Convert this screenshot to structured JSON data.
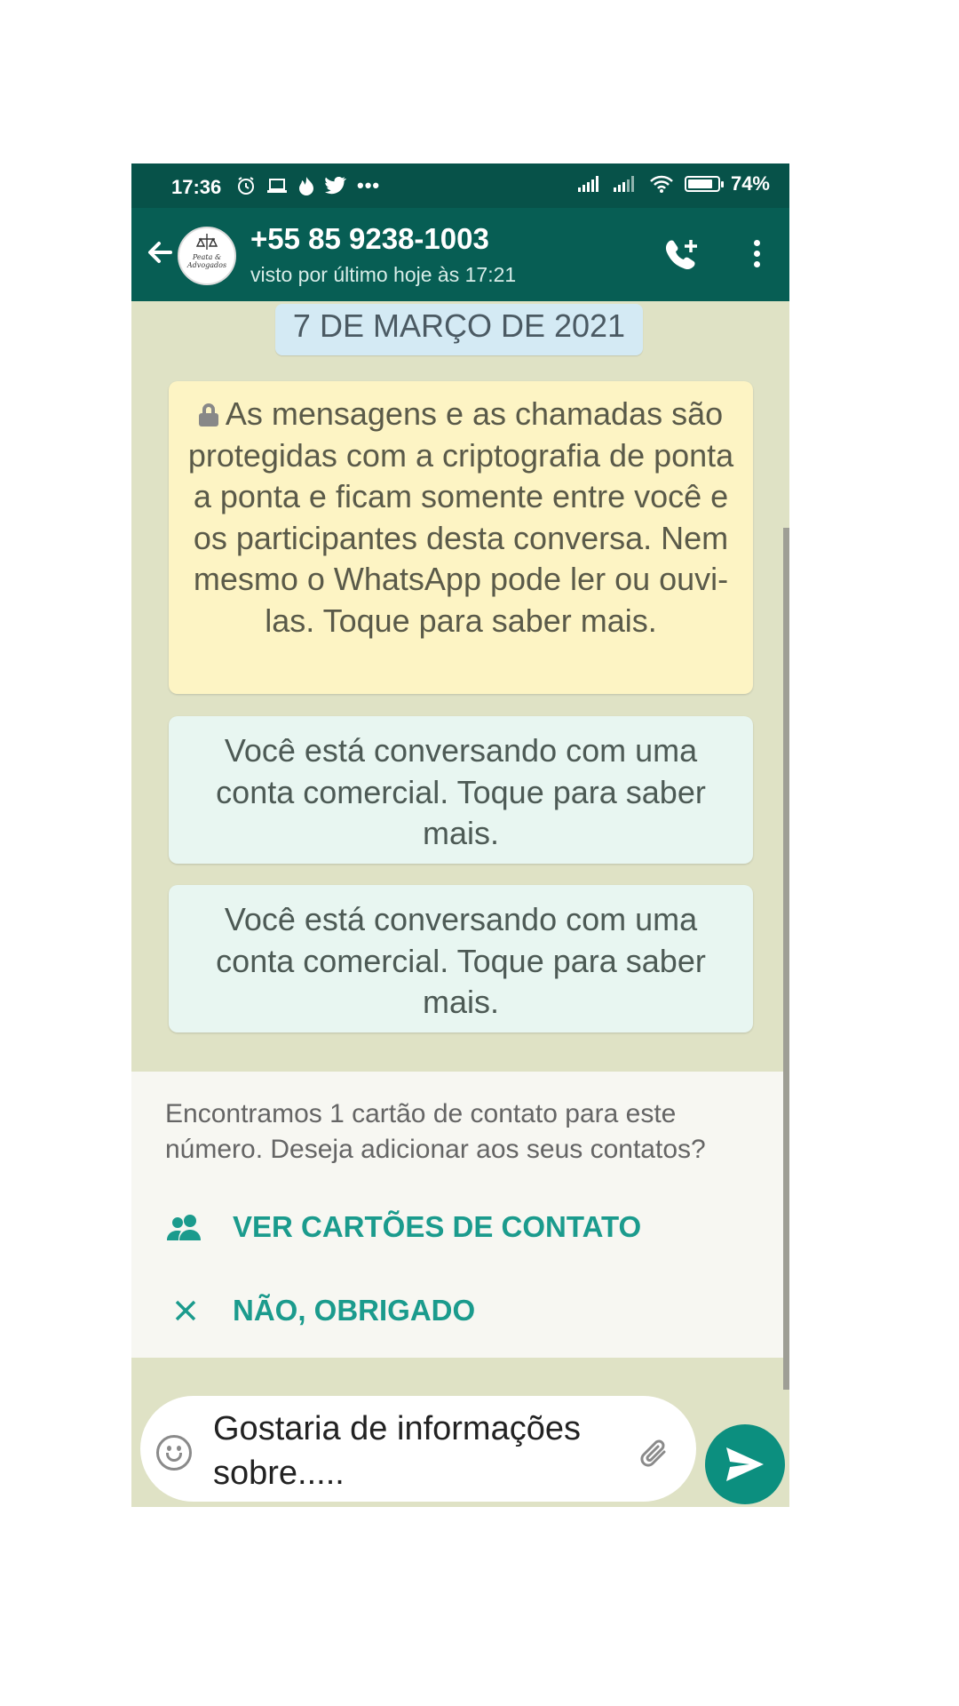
{
  "status_bar": {
    "time": "17:36",
    "battery": "74%",
    "battery_level": 0.74
  },
  "header": {
    "contact_name": "+55 85 9238-1003",
    "last_seen": "visto por último hoje às 17:21",
    "avatar_text": "Peata & Advogados"
  },
  "chat": {
    "date_chip": "7 DE MARÇO DE 2021",
    "encryption_notice": "As mensagens e as chamadas são protegidas com a criptografia de ponta a ponta e ficam somente entre você e os participantes desta conversa. Nem mesmo o WhatsApp pode ler ou ouvi-las. Toque para saber mais.",
    "business_notices": [
      "Você está conversando com uma conta comercial. Toque para saber mais.",
      "Você está conversando com uma conta comercial. Toque para saber mais."
    ]
  },
  "contact_card": {
    "message": "Encontramos 1 cartão de contato para este número. Deseja adicionar aos seus contatos?",
    "view_label": "VER CARTÕES DE CONTATO",
    "dismiss_label": "NÃO, OBRIGADO"
  },
  "composer": {
    "text": "Gostaria de informações sobre....."
  },
  "colors": {
    "header": "#075e54",
    "accent": "#1b9b8d",
    "send": "#0c8f7f",
    "encryption_bg": "#fdf4c4",
    "business_bg": "#e8f6f1",
    "chat_bg": "#dfe2c5"
  },
  "icons": [
    "alarm-icon",
    "laptop-icon",
    "flame-icon",
    "twitter-icon",
    "more-dots-icon",
    "signal-icon",
    "wifi-icon",
    "battery-icon",
    "back-arrow-icon",
    "add-call-icon",
    "overflow-menu-icon",
    "lock-icon",
    "contacts-icon",
    "close-icon",
    "emoji-icon",
    "attach-icon",
    "send-icon"
  ]
}
